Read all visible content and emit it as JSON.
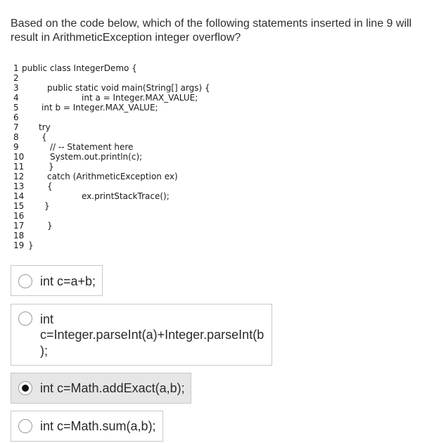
{
  "question": {
    "text": "Based on the code below, which of the following statements inserted in line 9 will result in ArithmeticException integer overflow?"
  },
  "code": {
    "lines": [
      {
        "num": "1",
        "text": "public class IntegerDemo {"
      },
      {
        "num": "2",
        "text": ""
      },
      {
        "num": "3",
        "text": "public static void main(String[] args) {"
      },
      {
        "num": "4",
        "text": "int a = Integer.MAX_VALUE;"
      },
      {
        "num": "5",
        "text": "int b = Integer.MAX_VALUE;"
      },
      {
        "num": "6",
        "text": ""
      },
      {
        "num": "7",
        "text": "try"
      },
      {
        "num": "8",
        "text": "{"
      },
      {
        "num": "9",
        "text": "// -- Statement here"
      },
      {
        "num": "10",
        "text": "System.out.println(c);"
      },
      {
        "num": "11",
        "text": "}"
      },
      {
        "num": "12",
        "text": "catch (ArithmeticException ex)"
      },
      {
        "num": "13",
        "text": "{"
      },
      {
        "num": "14",
        "text": "ex.printStackTrace();"
      },
      {
        "num": "15",
        "text": "}"
      },
      {
        "num": "16",
        "text": ""
      },
      {
        "num": "17",
        "text": "}"
      },
      {
        "num": "18",
        "text": ""
      },
      {
        "num": "19",
        "text": "}"
      }
    ]
  },
  "options": [
    {
      "label": "int c=a+b;",
      "selected": false
    },
    {
      "label": "int c=Integer.parseInt(a)+Integer.parseInt(b);",
      "label_lines": [
        "int",
        "c=Integer.parseInt(a)+Integer.parseInt(b",
        ");"
      ],
      "selected": false
    },
    {
      "label": "int c=Math.addExact(a,b);",
      "selected": true
    },
    {
      "label": "int c=Math.sum(a,b);",
      "selected": false
    }
  ],
  "colors": {
    "selected_bg": "#e6e6e6",
    "border": "#c8c8c8",
    "text": "#2a2a2a"
  }
}
